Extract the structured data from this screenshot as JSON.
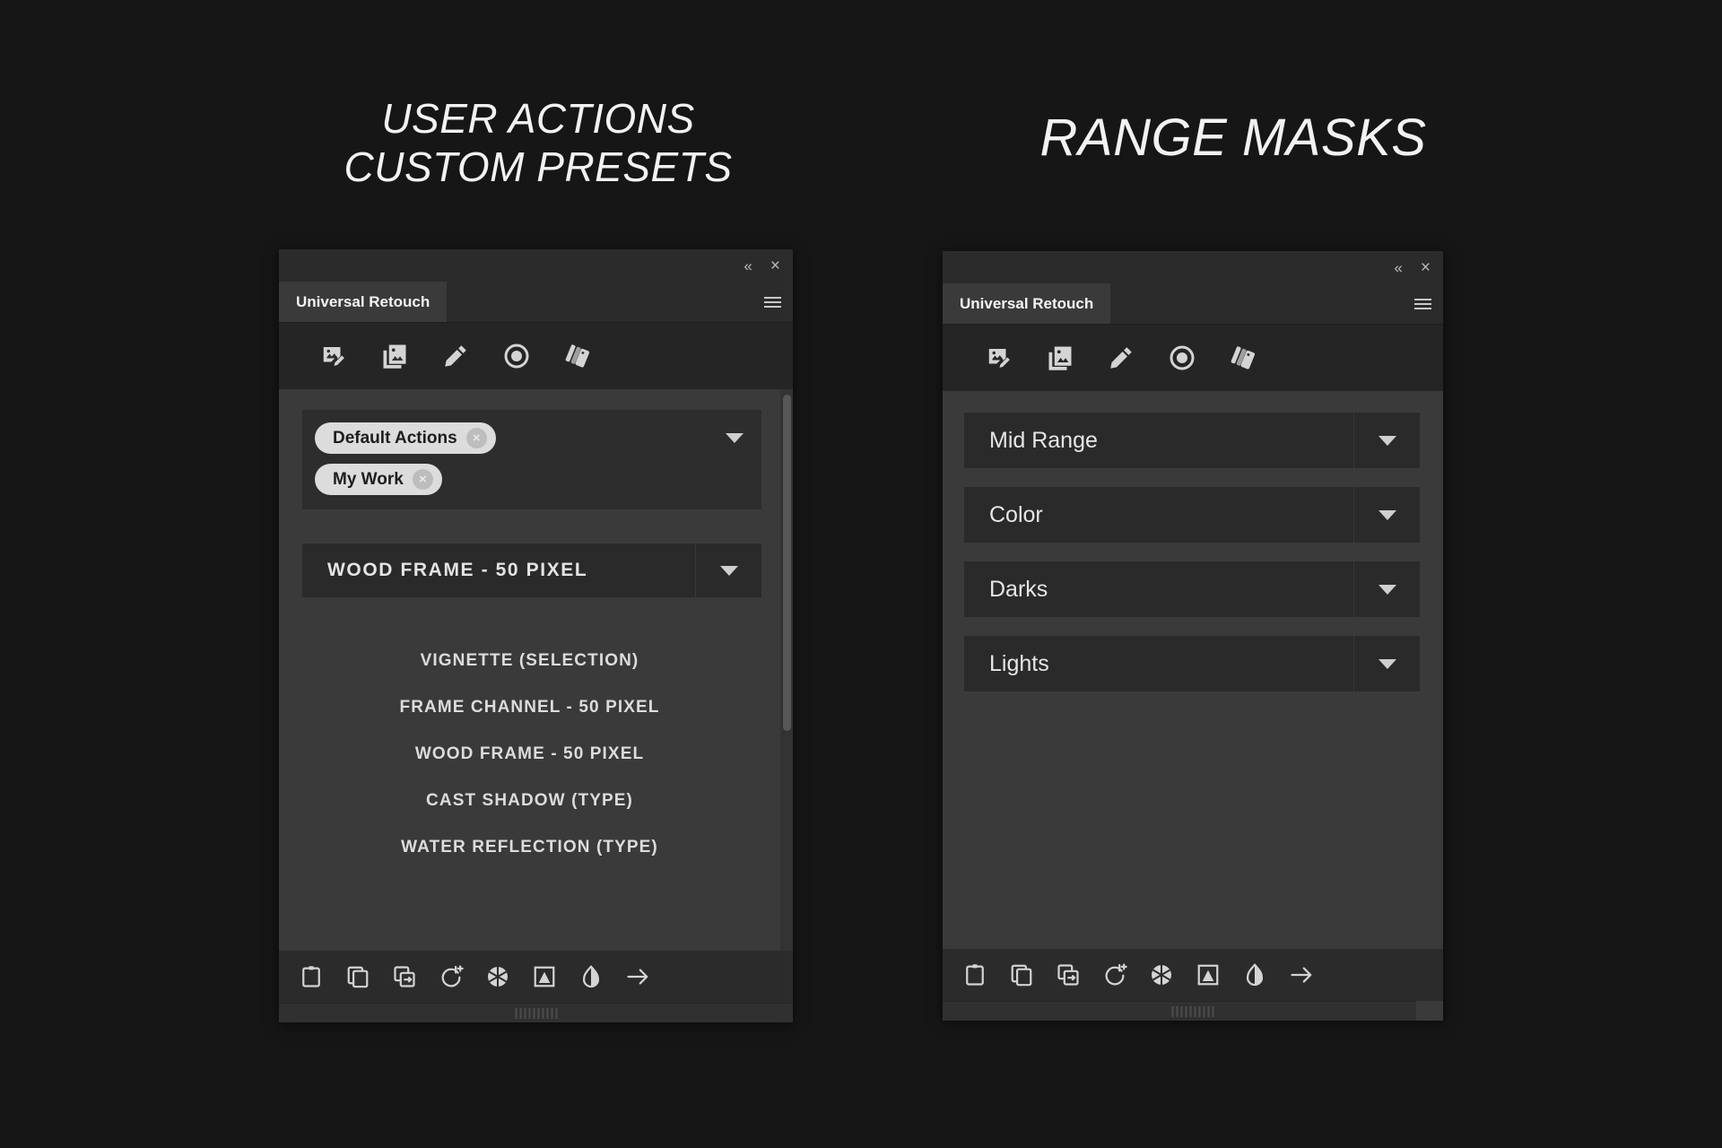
{
  "background_color": "#161616",
  "headings": {
    "left": "USER ACTIONS\nCUSTOM PRESETS",
    "right": "RANGE MASKS"
  },
  "window_controls": {
    "collapse_label": "«",
    "close_label": "×"
  },
  "panel_left": {
    "tab_label": "Universal Retouch",
    "toolbar_icons": [
      "image-edit-icon",
      "image-stack-icon",
      "pencil-icon",
      "record-circle-icon",
      "swatches-icon"
    ],
    "tags": [
      {
        "label": "Default Actions",
        "remove_label": "×"
      },
      {
        "label": "My Work",
        "remove_label": "×"
      }
    ],
    "preset_select": {
      "value": "WOOD FRAME - 50 PIXEL"
    },
    "preset_items": [
      "VIGNETTE (SELECTION)",
      "FRAME CHANNEL - 50 PIXEL",
      "WOOD FRAME - 50 PIXEL",
      "CAST SHADOW (TYPE)",
      "WATER REFLECTION (TYPE)"
    ],
    "bottom_icons": [
      "clipboard-icon",
      "copy-icon",
      "duplicate-to-icon",
      "rotate-add-icon",
      "aperture-icon",
      "image-mask-icon",
      "contrast-droplet-icon",
      "arrow-right-icon"
    ]
  },
  "panel_right": {
    "tab_label": "Universal Retouch",
    "toolbar_icons": [
      "image-edit-icon",
      "image-stack-icon",
      "pencil-icon",
      "record-circle-icon",
      "swatches-icon"
    ],
    "range_masks": [
      {
        "label": "Mid Range"
      },
      {
        "label": "Color"
      },
      {
        "label": "Darks"
      },
      {
        "label": "Lights"
      }
    ],
    "bottom_icons": [
      "clipboard-icon",
      "copy-icon",
      "duplicate-to-icon",
      "rotate-add-icon",
      "aperture-icon",
      "image-mask-icon",
      "contrast-droplet-icon",
      "arrow-right-icon"
    ]
  },
  "colors": {
    "panel_bg": "#3a3a3a",
    "panel_chrome": "#2b2b2b",
    "control_bg": "#2a2a2a",
    "tag_bg": "#dcdcdc",
    "text_light": "#e4e4e4"
  }
}
